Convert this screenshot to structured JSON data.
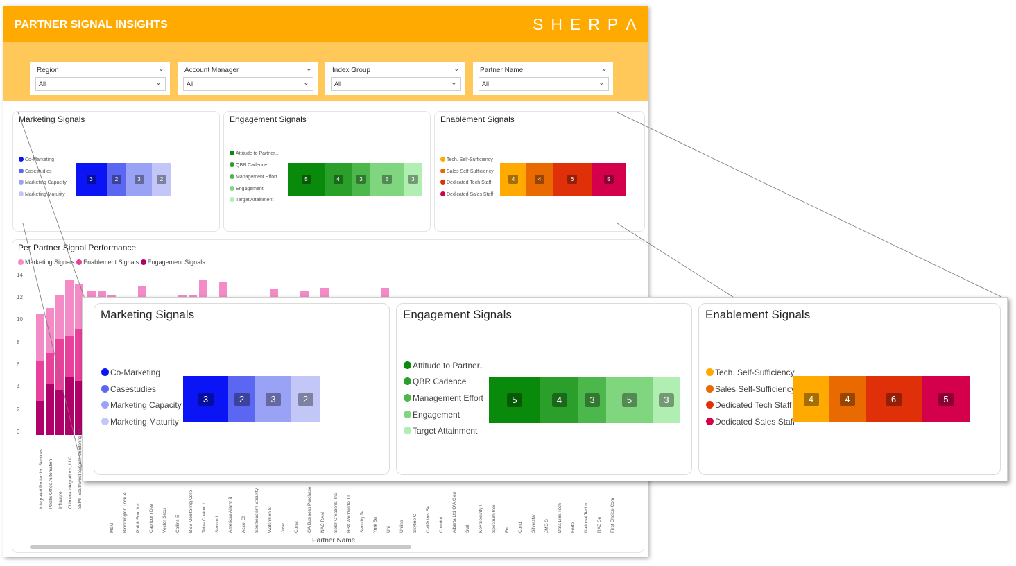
{
  "header": {
    "title": "PARTNER SIGNAL INSIGHTS",
    "logo": "SHERPΛ",
    "bg": "#ffaa00",
    "filter_bg": "#ffc859"
  },
  "filters": [
    {
      "label": "Region",
      "value": "All"
    },
    {
      "label": "Account Manager",
      "value": "All"
    },
    {
      "label": "Index Group",
      "value": "All"
    },
    {
      "label": "Partner Name",
      "value": "All"
    }
  ],
  "marketing": {
    "title": "Marketing Signals",
    "items": [
      {
        "label": "Co-Marketing",
        "value": "3",
        "color": "#0a14f5"
      },
      {
        "label": "Casestudies",
        "value": "2",
        "color": "#5b67f2"
      },
      {
        "label": "Marketing Capacity",
        "value": "3",
        "color": "#9aa2f5"
      },
      {
        "label": "Marketing Maturity",
        "value": "2",
        "color": "#c3c7f7"
      }
    ]
  },
  "engagement": {
    "title": "Engagement Signals",
    "items": [
      {
        "label": "Attitude to Partner...",
        "value": "5",
        "color": "#0a8a0a"
      },
      {
        "label": "QBR Cadence",
        "value": "4",
        "color": "#2aa02a"
      },
      {
        "label": "Management Effort",
        "value": "3",
        "color": "#4cb84c"
      },
      {
        "label": "Engagement",
        "value": "5",
        "color": "#7fd67f"
      },
      {
        "label": "Target Attainment",
        "value": "3",
        "color": "#b1eeb1"
      }
    ]
  },
  "enablement": {
    "title": "Enablement Signals",
    "items": [
      {
        "label": "Tech. Self-Sufficiency",
        "value": "4",
        "color": "#ffaa00"
      },
      {
        "label": "Sales Self-Sufficiency",
        "value": "4",
        "color": "#e86a00"
      },
      {
        "label": "Dedicated Tech Staff",
        "value": "6",
        "color": "#e0300a"
      },
      {
        "label": "Dedicated Sales Staff",
        "value": "5",
        "color": "#d4004c"
      }
    ]
  },
  "performance": {
    "title": "Per Partner Signal Performance",
    "xlabel": "Partner Name",
    "legend": [
      {
        "label": "Marketing Signals",
        "color": "#f38bc6"
      },
      {
        "label": "Enablement Signals",
        "color": "#e8409b"
      },
      {
        "label": "Engagement Signals",
        "color": "#b0006a"
      }
    ],
    "yticks": [
      "14",
      "12",
      "10",
      "8",
      "6",
      "4",
      "2",
      "0"
    ],
    "partner_names": [
      "Integrated Protection Services",
      "Pacific Office Automation",
      "Infrasure",
      "Chimera Integrations, LLC",
      "SSMI- Southwest System Monitoring Inc.",
      "McM",
      "Bloomington Lock &",
      "Phil & Son, Inc",
      "Capricorn Dev",
      "Vector Secu",
      "Collins E",
      "BSS Monitoring Corp",
      "Telas Custom I",
      "Secure I",
      "American Alarm &",
      "Accel Cl",
      "Southeastern Security",
      "Watchmen S",
      "Jose",
      "Consl",
      "GA Business Purchase",
      "NAC RAM",
      "Solar Creations, Inc",
      "HBA Worldwide, LL",
      "Security Te",
      "York Se",
      "Uni",
      "Unline",
      "Skyline C",
      "CellPoints Se",
      "Comdot",
      "Alberta Ltd O/A Clea",
      "Stal",
      "Key Security I",
      "Spectrum Inte",
      "Fo",
      "Cond",
      "Silverstar",
      "JMG S",
      "Data Link Tech",
      "Forte",
      "National Techn",
      "RAE Se",
      "First Choice Com"
    ]
  }
}
